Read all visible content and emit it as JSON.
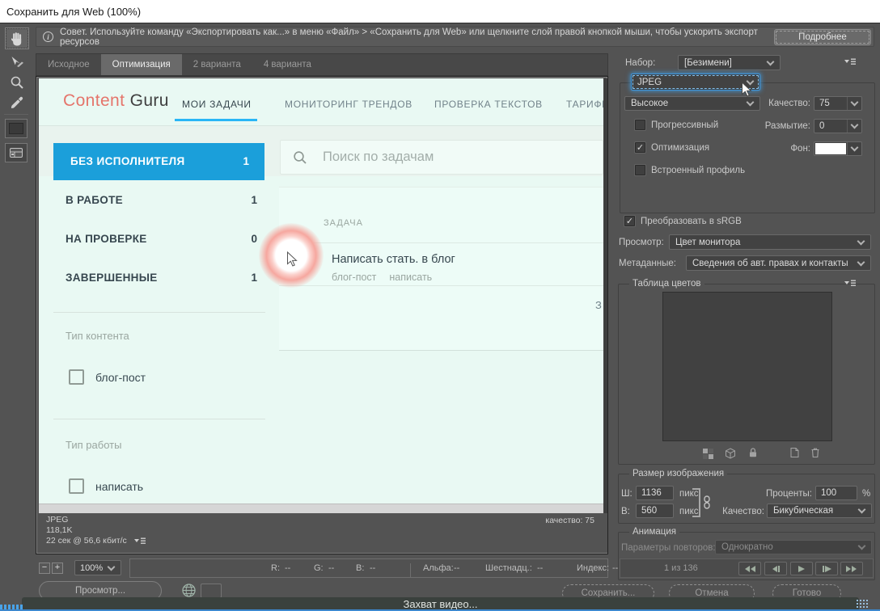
{
  "window": {
    "title": "Сохранить для Web (100%)"
  },
  "tipbar": {
    "text": "Совет. Используйте команду «Экспортировать как...» в меню «Файл» > «Сохранить для Web» или щелкните слой правой кнопкой мыши, чтобы ускорить экспорт ресурсов",
    "more": "Подробнее"
  },
  "view_tabs": {
    "original": "Исходное",
    "optimized": "Оптимизация",
    "two_up": "2 варианта",
    "four_up": "4 варианта"
  },
  "preview": {
    "site": {
      "logo_red": "Content",
      "logo_dark": " Guru",
      "nav1": "МОИ ЗАДАЧИ",
      "nav2": "МОНИТОРИНГ ТРЕНДОВ",
      "nav3": "ПРОВЕРКА ТЕКСТОВ",
      "nav4": "ТАРИФН",
      "sidebar": {
        "item1_label": "БЕЗ ИСПОЛНИТЕЛЯ",
        "item1_count": "1",
        "item2_label": "В РАБОТЕ",
        "item2_count": "1",
        "item3_label": "НА ПРОВЕРКЕ",
        "item3_count": "0",
        "item4_label": "ЗАВЕРШЕННЫЕ",
        "item4_count": "1"
      },
      "filter1_title": "Тип контента",
      "filter1_option": "блог-пост",
      "filter2_title": "Тип работы",
      "filter2_option": "написать",
      "search_placeholder": "Поиск по задачам",
      "table_header": "ЗАДАЧА",
      "task_title": "Написать стать. в блог",
      "task_tag1": "блог-пост",
      "task_tag2": "написать",
      "cut_text": "З"
    },
    "status": {
      "format": "JPEG",
      "size": "118,1K",
      "rate": "22 сек @ 56,6 кбит/с",
      "quality": "качество: 75"
    }
  },
  "panel": {
    "preset_label": "Набор:",
    "preset_value": "[Безимени]",
    "format_value": "JPEG",
    "compression_value": "Высокое",
    "quality_label": "Качество:",
    "quality_value": "75",
    "progressive_label": "Прогрессивный",
    "blur_label": "Размытие:",
    "blur_value": "0",
    "optimized_label": "Оптимизация",
    "matte_label": "Фон:",
    "embedded_label": "Встроенный профиль",
    "srgb_label": "Преобразовать в sRGB",
    "preview_label": "Просмотр:",
    "preview_value": "Цвет монитора",
    "metadata_label": "Метаданные:",
    "metadata_value": "Сведения об авт. правах и контакты",
    "color_table_title": "Таблица цветов",
    "size": {
      "title": "Размер изображения",
      "w_label": "Ш:",
      "w_value": "1136",
      "w_unit": "пикс.",
      "h_label": "В:",
      "h_value": "560",
      "h_unit": "пикс.",
      "percent_label": "Проценты:",
      "percent_value": "100",
      "percent_unit": "%",
      "resample_label": "Качество:",
      "resample_value": "Бикубическая"
    },
    "animation": {
      "title": "Анимация",
      "loop_label": "Параметры повторов:",
      "loop_value": "Однократно",
      "frame": "1 из 136"
    }
  },
  "statusbar": {
    "zoom_out": "−",
    "zoom_in": "+",
    "zoom_value": "100%",
    "r_label": "R:",
    "r_value": "--",
    "g_label": "G:",
    "g_value": "--",
    "b_label": "B:",
    "b_value": "--",
    "alpha_label": "Альфа:",
    "alpha_value": "--",
    "hex_label": "Шестнадц.:",
    "hex_value": "--",
    "index_label": "Индекс:",
    "index_value": "--"
  },
  "footer": {
    "preview_button": "Просмотр...",
    "save_button": "Сохранить...",
    "cancel_button": "Отмена",
    "done_button": "Готово"
  },
  "overlay": {
    "capture_text": "Захват видео..."
  },
  "icons": {
    "hand": "hand-tool",
    "slice_select": "slice-select-tool",
    "zoom": "zoom-tool",
    "eyedropper": "eyedropper-tool",
    "panel_menu": "flyout-triangle-with-lines",
    "search": "magnifier",
    "link": "chain",
    "playback": "media-transport-arrows"
  },
  "colors": {
    "dialog_bg": "#535353",
    "mint_bg": "#e9f9f3",
    "accent_blue": "#1b9fda",
    "underline_blue": "#29b6f6",
    "logo_red": "#e5756b",
    "focus_blue": "#3e96dd",
    "overlay_bg": "#3a413d",
    "bottom_line_blue": "#3c87cd"
  }
}
